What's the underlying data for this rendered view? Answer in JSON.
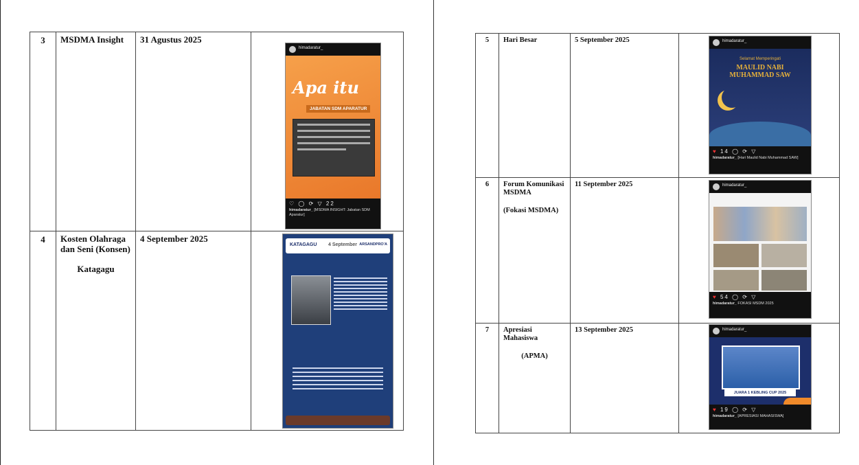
{
  "left_page": {
    "rows": [
      {
        "no": "3",
        "title": "MSDMA Insight",
        "subtitle": "",
        "date": "31 Agustus 2025",
        "post": {
          "user": "himadaratur_",
          "poster_title": "Apa itu",
          "poster_sub": "JABATAN SDM APARATUR",
          "likes": "22",
          "caption_user": "himadaratur_",
          "caption": "[MSDMA INSIGHT: Jabatan SDM Aparatur]"
        }
      },
      {
        "no": "4",
        "title": "Kosten Olahraga dan Seni (Konsen)",
        "subtitle": "Katagagu",
        "date": "4 September 2025",
        "post": {
          "user": "KATAGAGU",
          "poster_title": "4 September",
          "poster_sub": "ARSANDPRO'A"
        }
      }
    ]
  },
  "right_page": {
    "rows": [
      {
        "no": "5",
        "title": "Hari Besar",
        "subtitle": "",
        "date": "5 September 2025",
        "post": {
          "user": "himadaratur_",
          "poster_title": "MAULID NABI MUHAMMAD SAW",
          "poster_sub": "Selamat Memperingati",
          "likes": "14",
          "caption_user": "himadaratur_",
          "caption": "[Hari Maulid Nabi Muhammad SAW]"
        }
      },
      {
        "no": "6",
        "title": "Forum Komunikasi MSDMA",
        "subtitle": "(Fokasi MSDMA)",
        "date": "11 September 2025",
        "post": {
          "user": "himadaratur_",
          "likes": "54",
          "caption_user": "himadaratur_",
          "caption": "FOKASI MSDM 2025"
        }
      },
      {
        "no": "7",
        "title": "Apresiasi Mahasiswa",
        "subtitle": "(APMA)",
        "date": "13 September 2025",
        "post": {
          "user": "himadaratur_",
          "poster_sub": "JUARA 1 KEBLING CUP 2025",
          "likes": "19",
          "caption_user": "himadaratur_",
          "caption": "[APRESIASI MAHASISWA]"
        }
      }
    ]
  },
  "colors": {
    "orange": "#f08a2a",
    "navy": "#1d2f6b",
    "blue": "#2b5fa8",
    "gold": "#e8b23a"
  }
}
